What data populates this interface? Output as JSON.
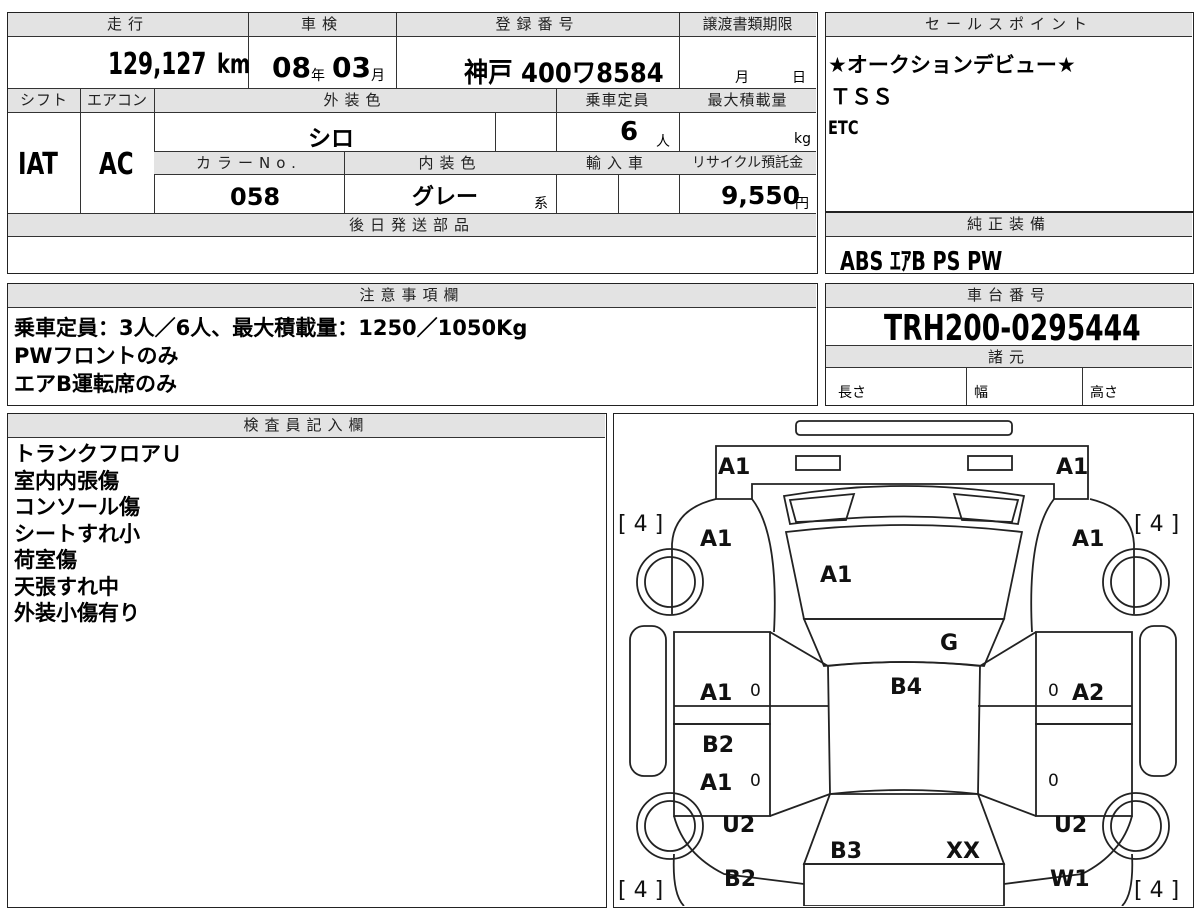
{
  "main": {
    "mileage_header": "走行",
    "mileage_value": "129,127",
    "mileage_unit": "km",
    "inspection_header": "車検",
    "inspection_year": "08",
    "inspection_year_unit": "年",
    "inspection_month": "03",
    "inspection_month_unit": "月",
    "registration_header": "登録番号",
    "registration_value": "神戸 400ワ8584",
    "transfer_header": "譲渡書類期限",
    "transfer_month_unit": "月",
    "transfer_day_unit": "日",
    "shift_header": "シフト",
    "shift_value": "IAT",
    "ac_header": "エアコン",
    "ac_value": "AC",
    "exterior_header": "外装色",
    "exterior_value": "シロ",
    "capacity_header": "乗車定員",
    "capacity_value": "6",
    "capacity_unit": "人",
    "maxload_header": "最大積載量",
    "maxload_unit": "kg",
    "colorno_header": "カラーNo.",
    "colorno_value": "058",
    "interior_header": "内装色",
    "interior_value": "グレー",
    "interior_suffix": "系",
    "import_header": "輸入車",
    "recycle_header": "リサイクル預託金",
    "recycle_value": "9,550",
    "recycle_unit": "円",
    "later_parts_header": "後日発送部品"
  },
  "sales_point": {
    "header": "セールスポイント",
    "lines": [
      "★オークションデビュー★",
      "ＴＳＳ",
      "ETC"
    ]
  },
  "genuine_equipment": {
    "header": "純正装備",
    "value": "ABS ｴｱB PS PW"
  },
  "notes": {
    "header": "注意事項欄",
    "lines": [
      "乗車定員：3人／6人、最大積載量：1250／1050Kg",
      "PWフロントのみ",
      "エアB運転席のみ"
    ]
  },
  "chassis": {
    "header": "車台番号",
    "value": "TRH200-0295444",
    "specs_header": "諸元",
    "length_label": "長さ",
    "width_label": "幅",
    "height_label": "高さ"
  },
  "inspector": {
    "header": "検査員記入欄",
    "lines": [
      "トランクフロアＵ",
      "室内内張傷",
      "コンソール傷",
      "シートすれ小",
      "荷室傷",
      "天張すれ中",
      "外装小傷有り"
    ]
  },
  "diagram": {
    "marks": {
      "front_left_top": "A1",
      "front_right_top": "A1",
      "fender_left": "A1",
      "fender_right": "A1",
      "hood": "A1",
      "windshield": "G",
      "roof": "B4",
      "front_door_left": "A1",
      "front_door_right": "A2",
      "rear_door_left_upper": "B2",
      "rear_door_left_lower": "A1",
      "quarter_left": "U2",
      "quarter_right": "U2",
      "rear_left": "B2",
      "rear_right": "W1",
      "rear_center": "B3",
      "rear_center_right": "XX"
    },
    "zeros": [
      "0",
      "0",
      "0",
      "0"
    ],
    "tire_marks": [
      "[ 4 ]",
      "[ 4 ]",
      "[ 4 ]",
      "[ 4 ]"
    ]
  }
}
